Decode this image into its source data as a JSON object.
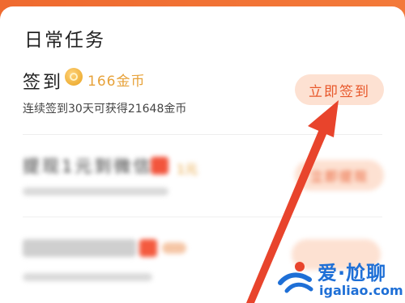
{
  "card": {
    "title": "日常任务"
  },
  "tasks": [
    {
      "title": "签到",
      "reward": "166金币",
      "description": "连续签到30天可获得21648金币",
      "button": "立即签到"
    },
    {
      "title": "提现1元到微信",
      "reward": "1元",
      "button": "立即提现"
    }
  ],
  "watermark": {
    "text_main": "爱·尬聊",
    "text_domain": "igaliao.com"
  },
  "colors": {
    "accent": "#e8582b",
    "button_bg": "#fde1d2",
    "coin": "#e7a23a",
    "arrow": "#e8442c",
    "watermark": "#1e6fd6"
  },
  "icons": {
    "coin": "coin-icon",
    "wechat": "wechat-red-envelope-icon",
    "arrow": "annotation-arrow-icon"
  }
}
